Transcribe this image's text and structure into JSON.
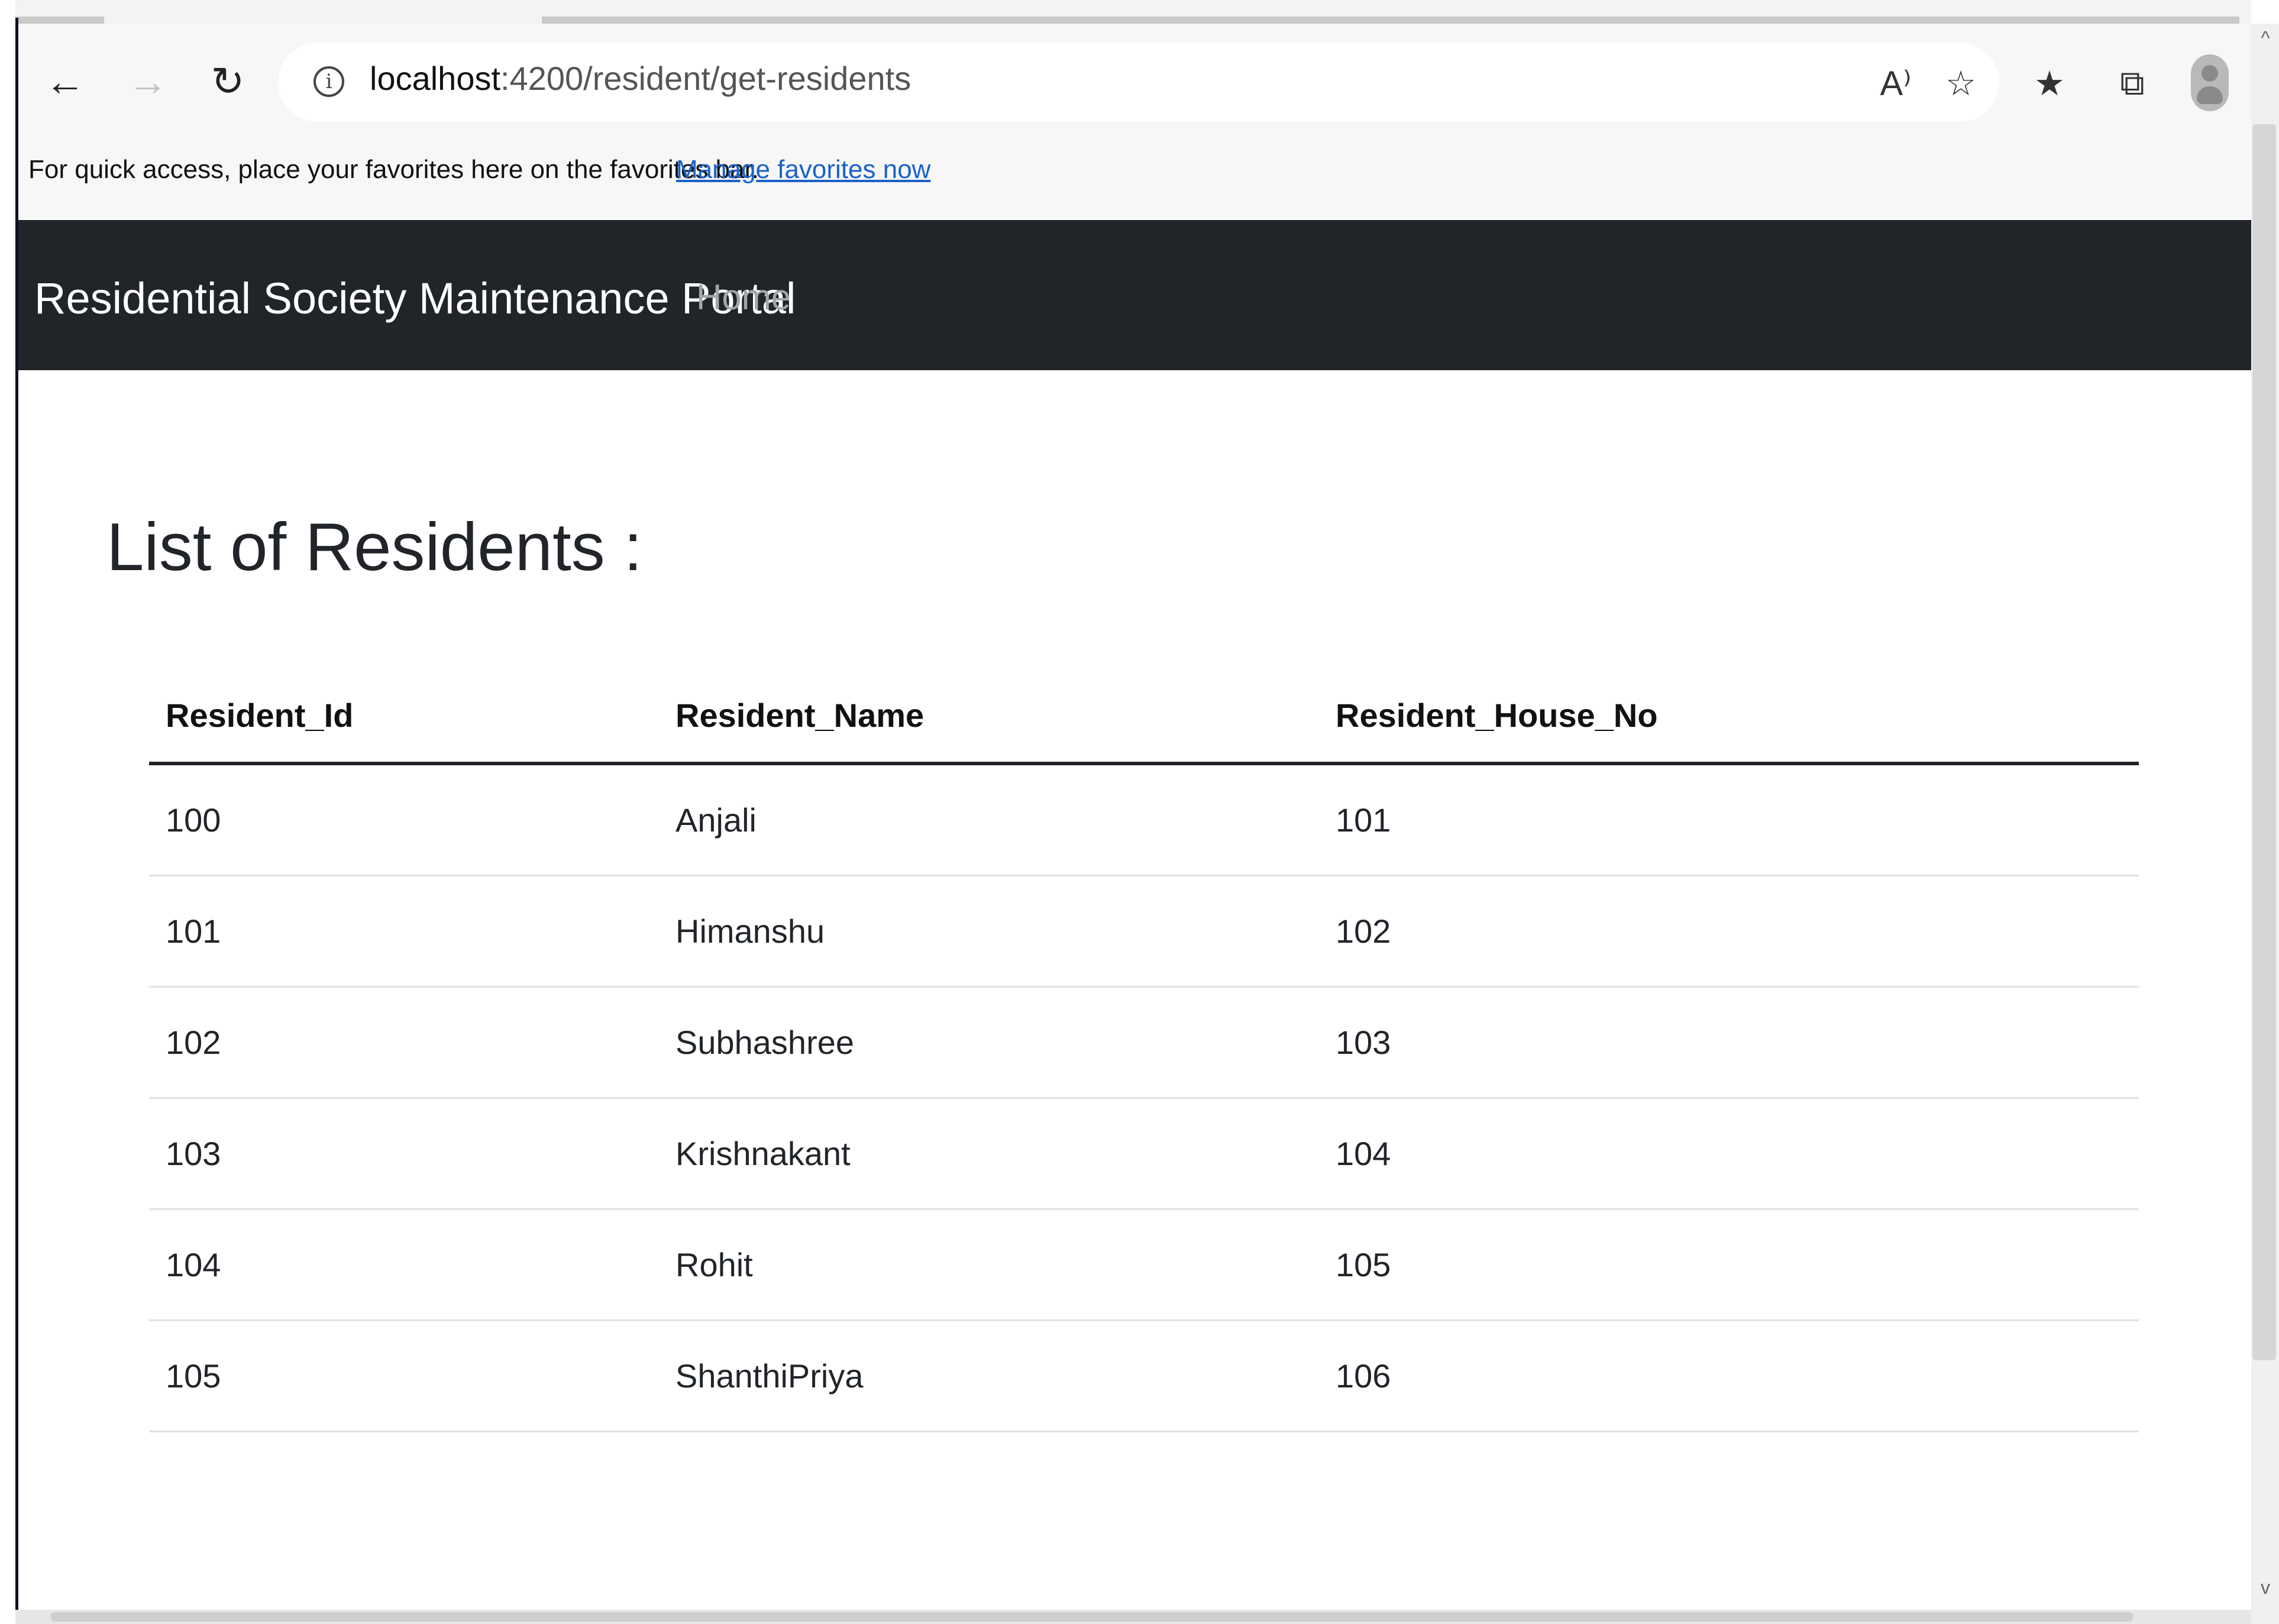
{
  "browser": {
    "back_icon": "←",
    "forward_icon": "→",
    "refresh_icon": "↻",
    "info_icon": "i",
    "url_host": "localhost",
    "url_rest": ":4200/resident/get-residents",
    "read_aloud_icon": "A⁾",
    "favorite_add_icon": "☆",
    "favorites_icon": "★",
    "collections_icon": "⧉",
    "scroll_up_icon": "^",
    "scroll_down_icon": "v"
  },
  "favorites_bar": {
    "text": "For quick access, place your favorites here on the favorites bar.",
    "link": "Manage favorites now"
  },
  "navbar": {
    "brand": "Residential Society Maintenance Portal",
    "home": "Home"
  },
  "page": {
    "title": "List of Residents :"
  },
  "table": {
    "headers": [
      "Resident_Id",
      "Resident_Name",
      "Resident_House_No"
    ],
    "rows": [
      [
        "100",
        "Anjali",
        "101"
      ],
      [
        "101",
        "Himanshu",
        "102"
      ],
      [
        "102",
        "Subhashree",
        "103"
      ],
      [
        "103",
        "Krishnakant",
        "104"
      ],
      [
        "104",
        "Rohit",
        "105"
      ],
      [
        "105",
        "ShanthiPriya",
        "106"
      ]
    ]
  }
}
